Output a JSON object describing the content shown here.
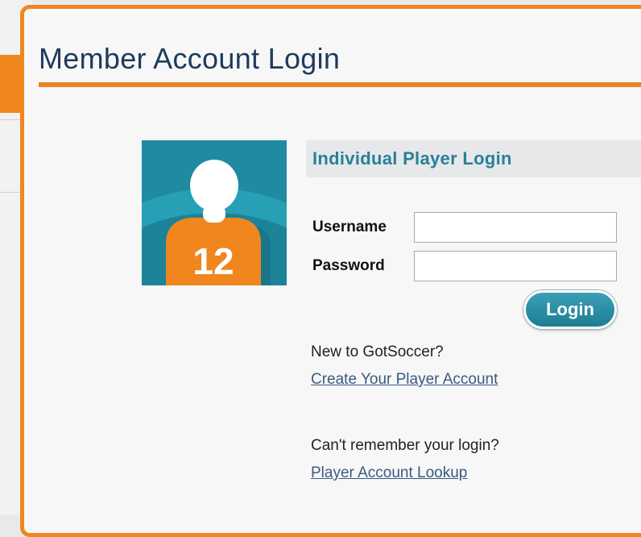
{
  "modal": {
    "title": "Member Account Login"
  },
  "login": {
    "section_title": "Individual Player Login",
    "avatar_number": "12",
    "username_label": "Username",
    "username_value": "",
    "password_label": "Password",
    "password_value": "",
    "login_button": "Login"
  },
  "signup": {
    "prompt": "New to GotSoccer?",
    "link": "Create Your Player Account"
  },
  "recovery": {
    "prompt": "Can't remember your login?",
    "link": "Player Account Lookup"
  },
  "colors": {
    "accent_orange": "#f0871e",
    "teal": "#1f8aa0",
    "title_navy": "#1f3a5c"
  },
  "icons": {
    "avatar": "player-silhouette-icon"
  }
}
